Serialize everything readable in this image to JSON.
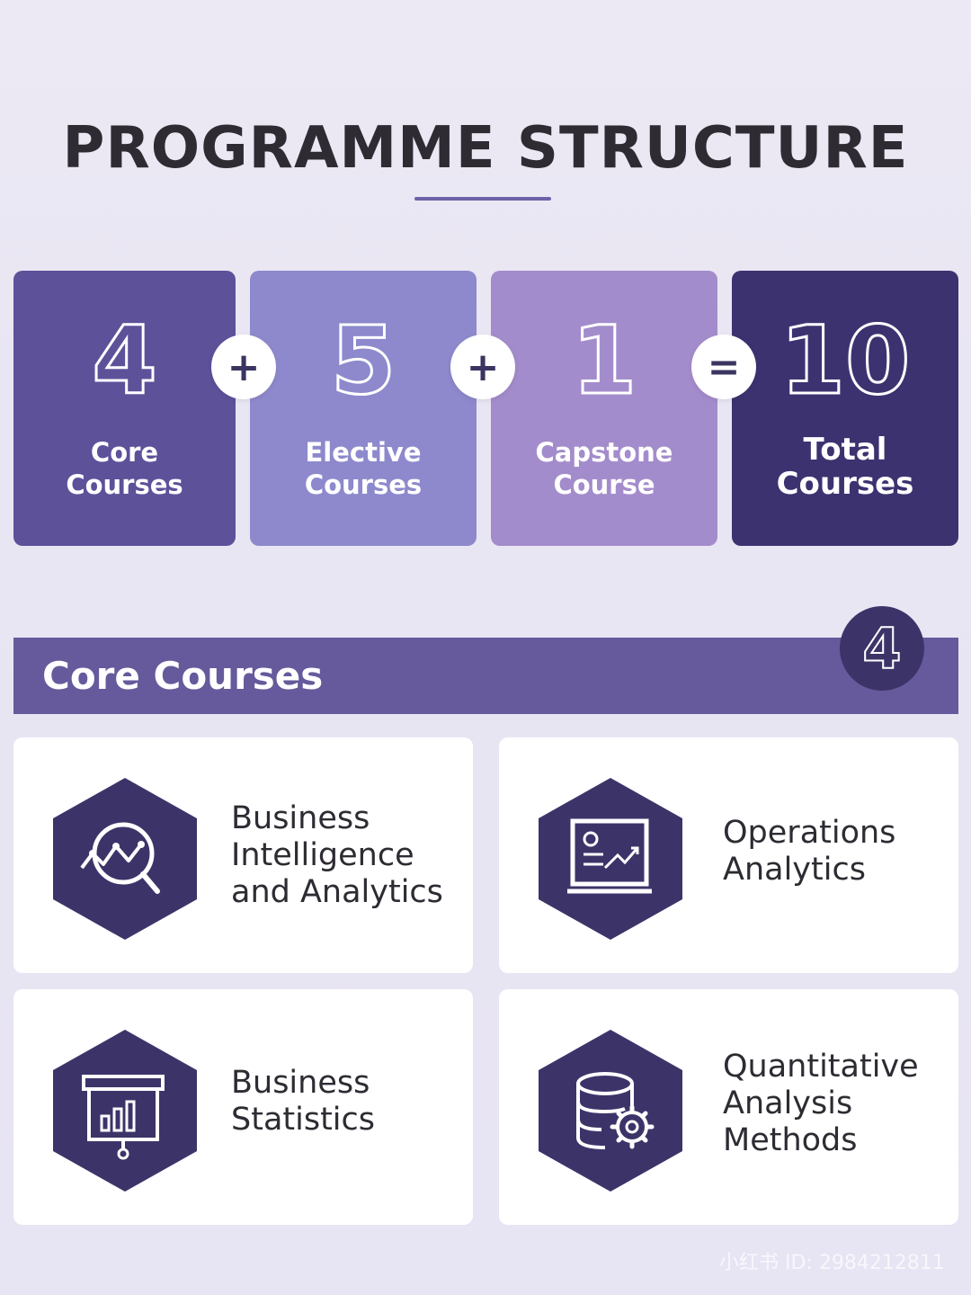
{
  "title": "PROGRAMME STRUCTURE",
  "stats": [
    {
      "number": "4",
      "label": "Core Courses",
      "color": "#5d519a"
    },
    {
      "operator": "+"
    },
    {
      "number": "5",
      "label": "Elective Courses",
      "color": "#8d89cc"
    },
    {
      "operator": "+"
    },
    {
      "number": "1",
      "label": "Capstone Course",
      "color": "#a38ccb"
    },
    {
      "operator": "="
    },
    {
      "number": "10",
      "label": "Total Courses",
      "color": "#3d3270"
    }
  ],
  "ops": [
    "+",
    "+",
    "="
  ],
  "section": {
    "title": "Core Courses",
    "count": "4"
  },
  "courses": [
    {
      "name": "Business Intelligence and Analytics",
      "icon": "analytics-search-icon"
    },
    {
      "name": "Operations Analytics",
      "icon": "presentation-chart-icon"
    },
    {
      "name": "Business Statistics",
      "icon": "bar-chart-board-icon"
    },
    {
      "name": "Quantitative Analysis Methods",
      "icon": "database-gear-icon"
    }
  ],
  "watermark": "小红书 ID: 2984212811",
  "colors": {
    "accent": "#665a9c",
    "dark": "#3c3469",
    "background": "#e9e6f3"
  }
}
